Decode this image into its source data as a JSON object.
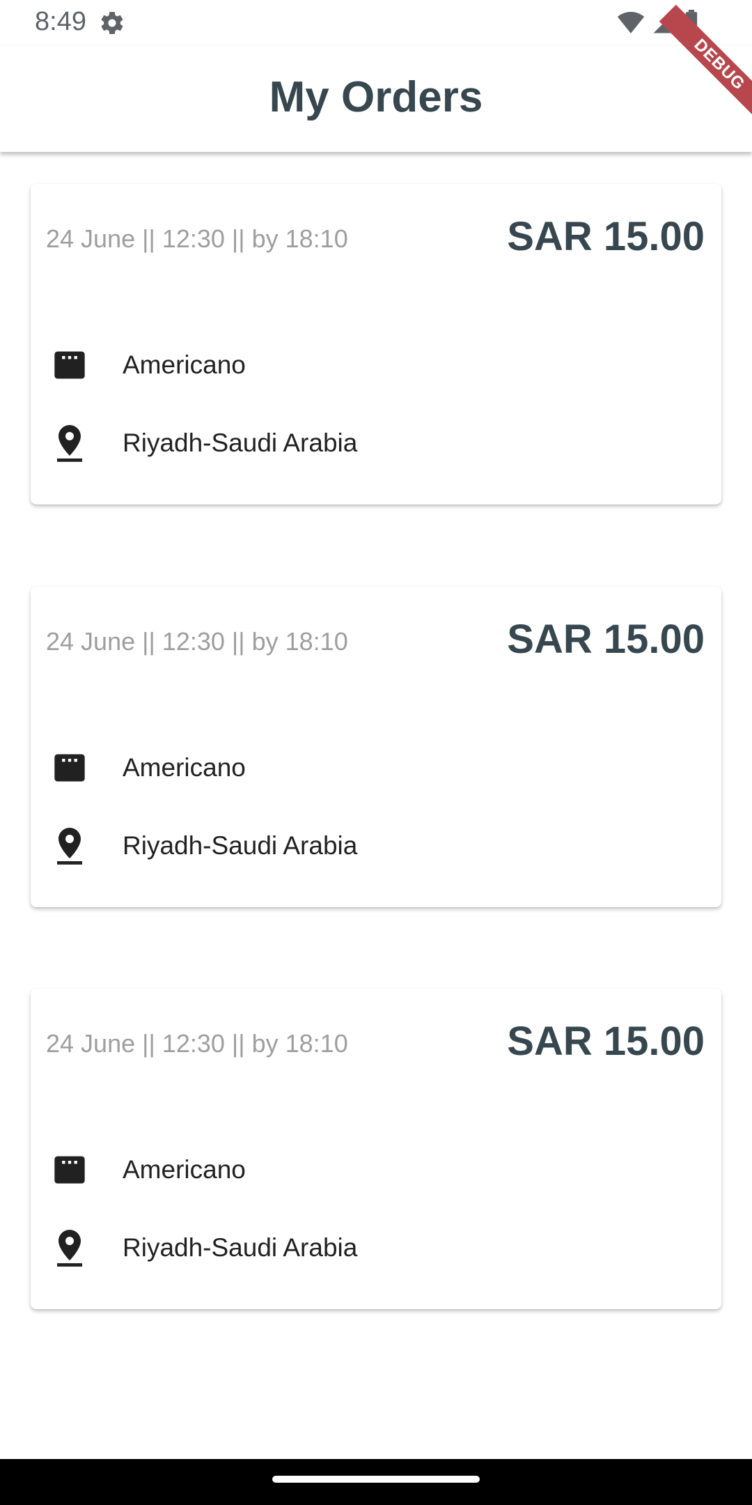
{
  "status_bar": {
    "time": "8:49",
    "icons": [
      "settings-icon",
      "wifi-icon",
      "signal-icon",
      "battery-icon"
    ]
  },
  "app_bar": {
    "title": "My Orders"
  },
  "debug_banner": {
    "label": "DEBUG"
  },
  "orders": [
    {
      "date": "24 June || 12:30 || by 18:10",
      "price": "SAR 15.00",
      "product": "Americano",
      "location": "Riyadh-Saudi Arabia",
      "product_icon": "menu-card-icon",
      "location_icon": "location-pin-icon"
    },
    {
      "date": "24 June || 12:30 || by 18:10",
      "price": "SAR 15.00",
      "product": "Americano",
      "location": "Riyadh-Saudi Arabia",
      "product_icon": "menu-card-icon",
      "location_icon": "location-pin-icon"
    },
    {
      "date": "24 June || 12:30 || by 18:10",
      "price": "SAR 15.00",
      "product": "Americano",
      "location": "Riyadh-Saudi Arabia",
      "product_icon": "menu-card-icon",
      "location_icon": "location-pin-icon"
    }
  ],
  "colors": {
    "title": "#37474f",
    "date": "#9e9e9e",
    "text": "#212121",
    "debug_banner": "#b7474d",
    "nav_bar": "#000000"
  }
}
